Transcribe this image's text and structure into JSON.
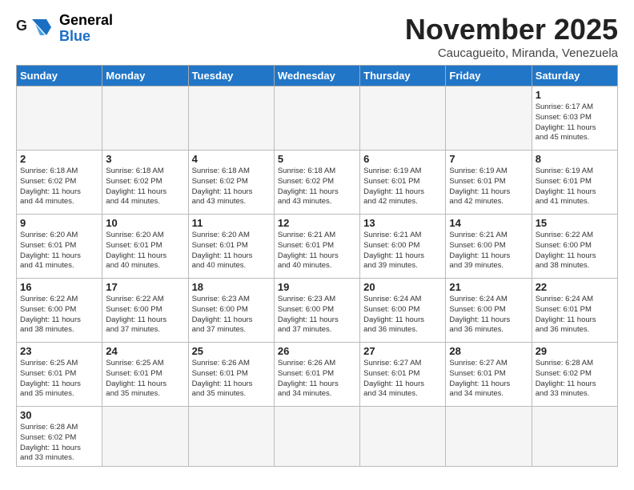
{
  "header": {
    "logo_general": "General",
    "logo_blue": "Blue",
    "month_title": "November 2025",
    "subtitle": "Caucagueito, Miranda, Venezuela"
  },
  "days_of_week": [
    "Sunday",
    "Monday",
    "Tuesday",
    "Wednesday",
    "Thursday",
    "Friday",
    "Saturday"
  ],
  "weeks": [
    [
      {
        "day": "",
        "info": ""
      },
      {
        "day": "",
        "info": ""
      },
      {
        "day": "",
        "info": ""
      },
      {
        "day": "",
        "info": ""
      },
      {
        "day": "",
        "info": ""
      },
      {
        "day": "",
        "info": ""
      },
      {
        "day": "1",
        "info": "Sunrise: 6:17 AM\nSunset: 6:03 PM\nDaylight: 11 hours\nand 45 minutes."
      }
    ],
    [
      {
        "day": "2",
        "info": "Sunrise: 6:18 AM\nSunset: 6:02 PM\nDaylight: 11 hours\nand 44 minutes."
      },
      {
        "day": "3",
        "info": "Sunrise: 6:18 AM\nSunset: 6:02 PM\nDaylight: 11 hours\nand 44 minutes."
      },
      {
        "day": "4",
        "info": "Sunrise: 6:18 AM\nSunset: 6:02 PM\nDaylight: 11 hours\nand 43 minutes."
      },
      {
        "day": "5",
        "info": "Sunrise: 6:18 AM\nSunset: 6:02 PM\nDaylight: 11 hours\nand 43 minutes."
      },
      {
        "day": "6",
        "info": "Sunrise: 6:19 AM\nSunset: 6:01 PM\nDaylight: 11 hours\nand 42 minutes."
      },
      {
        "day": "7",
        "info": "Sunrise: 6:19 AM\nSunset: 6:01 PM\nDaylight: 11 hours\nand 42 minutes."
      },
      {
        "day": "8",
        "info": "Sunrise: 6:19 AM\nSunset: 6:01 PM\nDaylight: 11 hours\nand 41 minutes."
      }
    ],
    [
      {
        "day": "9",
        "info": "Sunrise: 6:20 AM\nSunset: 6:01 PM\nDaylight: 11 hours\nand 41 minutes."
      },
      {
        "day": "10",
        "info": "Sunrise: 6:20 AM\nSunset: 6:01 PM\nDaylight: 11 hours\nand 40 minutes."
      },
      {
        "day": "11",
        "info": "Sunrise: 6:20 AM\nSunset: 6:01 PM\nDaylight: 11 hours\nand 40 minutes."
      },
      {
        "day": "12",
        "info": "Sunrise: 6:21 AM\nSunset: 6:01 PM\nDaylight: 11 hours\nand 40 minutes."
      },
      {
        "day": "13",
        "info": "Sunrise: 6:21 AM\nSunset: 6:00 PM\nDaylight: 11 hours\nand 39 minutes."
      },
      {
        "day": "14",
        "info": "Sunrise: 6:21 AM\nSunset: 6:00 PM\nDaylight: 11 hours\nand 39 minutes."
      },
      {
        "day": "15",
        "info": "Sunrise: 6:22 AM\nSunset: 6:00 PM\nDaylight: 11 hours\nand 38 minutes."
      }
    ],
    [
      {
        "day": "16",
        "info": "Sunrise: 6:22 AM\nSunset: 6:00 PM\nDaylight: 11 hours\nand 38 minutes."
      },
      {
        "day": "17",
        "info": "Sunrise: 6:22 AM\nSunset: 6:00 PM\nDaylight: 11 hours\nand 37 minutes."
      },
      {
        "day": "18",
        "info": "Sunrise: 6:23 AM\nSunset: 6:00 PM\nDaylight: 11 hours\nand 37 minutes."
      },
      {
        "day": "19",
        "info": "Sunrise: 6:23 AM\nSunset: 6:00 PM\nDaylight: 11 hours\nand 37 minutes."
      },
      {
        "day": "20",
        "info": "Sunrise: 6:24 AM\nSunset: 6:00 PM\nDaylight: 11 hours\nand 36 minutes."
      },
      {
        "day": "21",
        "info": "Sunrise: 6:24 AM\nSunset: 6:00 PM\nDaylight: 11 hours\nand 36 minutes."
      },
      {
        "day": "22",
        "info": "Sunrise: 6:24 AM\nSunset: 6:01 PM\nDaylight: 11 hours\nand 36 minutes."
      }
    ],
    [
      {
        "day": "23",
        "info": "Sunrise: 6:25 AM\nSunset: 6:01 PM\nDaylight: 11 hours\nand 35 minutes."
      },
      {
        "day": "24",
        "info": "Sunrise: 6:25 AM\nSunset: 6:01 PM\nDaylight: 11 hours\nand 35 minutes."
      },
      {
        "day": "25",
        "info": "Sunrise: 6:26 AM\nSunset: 6:01 PM\nDaylight: 11 hours\nand 35 minutes."
      },
      {
        "day": "26",
        "info": "Sunrise: 6:26 AM\nSunset: 6:01 PM\nDaylight: 11 hours\nand 34 minutes."
      },
      {
        "day": "27",
        "info": "Sunrise: 6:27 AM\nSunset: 6:01 PM\nDaylight: 11 hours\nand 34 minutes."
      },
      {
        "day": "28",
        "info": "Sunrise: 6:27 AM\nSunset: 6:01 PM\nDaylight: 11 hours\nand 34 minutes."
      },
      {
        "day": "29",
        "info": "Sunrise: 6:28 AM\nSunset: 6:02 PM\nDaylight: 11 hours\nand 33 minutes."
      }
    ],
    [
      {
        "day": "30",
        "info": "Sunrise: 6:28 AM\nSunset: 6:02 PM\nDaylight: 11 hours\nand 33 minutes."
      },
      {
        "day": "",
        "info": ""
      },
      {
        "day": "",
        "info": ""
      },
      {
        "day": "",
        "info": ""
      },
      {
        "day": "",
        "info": ""
      },
      {
        "day": "",
        "info": ""
      },
      {
        "day": "",
        "info": ""
      }
    ]
  ]
}
